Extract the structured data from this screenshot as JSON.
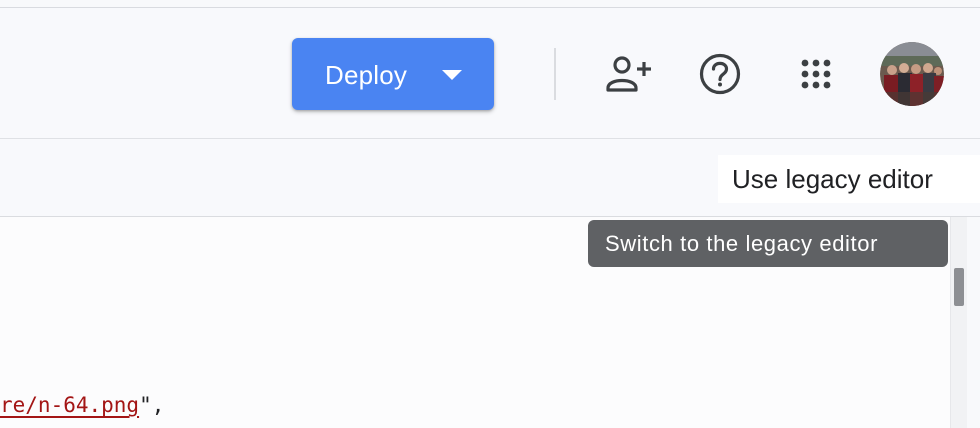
{
  "header": {
    "deploy_label": "Deploy",
    "icons": [
      "add-person-icon",
      "help-icon",
      "apps-grid-icon"
    ],
    "accent_color": "#4a84f2"
  },
  "toolbar": {
    "legacy_editor_label": "Use legacy editor"
  },
  "tooltip": {
    "text": "Switch to the legacy editor"
  },
  "editor": {
    "code_string": "re/n-64.png",
    "code_suffix": "\","
  }
}
